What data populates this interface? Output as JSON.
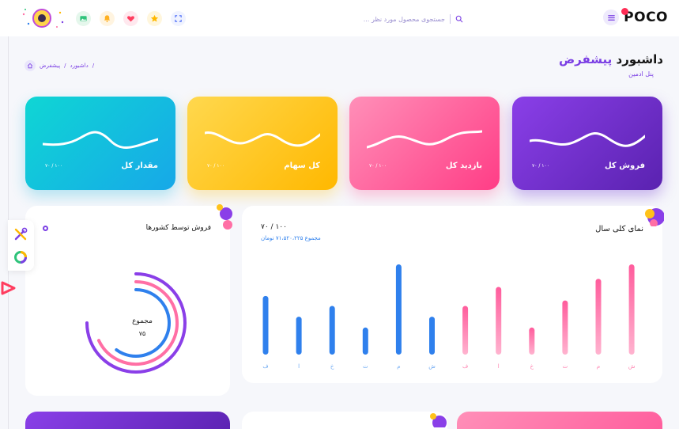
{
  "header": {
    "logo_text": "POCO",
    "search_placeholder": "جستجوی محصول مورد نظر ..."
  },
  "page": {
    "title_main": "داشبورد",
    "title_accent": "پیشفرض",
    "subtitle": "پنل ادمین",
    "breadcrumb": [
      "داشبورد",
      "پیشفرض"
    ]
  },
  "cards": [
    {
      "title": "فروش کل",
      "value": "۱۰۰ / ۷۰",
      "color": "#7b3fe4"
    },
    {
      "title": "بازدید کل",
      "value": "۱۰۰ / ۷۰",
      "color": "#ff4f92"
    },
    {
      "title": "کل سهام",
      "value": "۱۰۰ / ۷۰",
      "color": "#ffc21a"
    },
    {
      "title": "مقدار کل",
      "value": "۱۰۰ / ۷۰",
      "color": "#13c0de"
    }
  ],
  "sales_panel": {
    "title": "نمای کلی سال",
    "value": "۱۰۰ / ۷۰",
    "total": "مجموع ۷۱،۵۲۰،۲۲۵ تومان"
  },
  "country_panel": {
    "title": "فروش توسط کشورها",
    "center_label": "مجموع",
    "center_value": "۷۵"
  },
  "chart_data": {
    "type": "bar",
    "categories": [
      "ف",
      "ا",
      "خ",
      "ت",
      "م",
      "ش",
      "ف",
      "ا",
      "خ",
      "ت",
      "م",
      "ش"
    ],
    "series": [
      {
        "values": [
          65,
          42,
          54,
          30,
          100,
          42,
          null,
          null,
          null,
          null,
          null,
          null
        ],
        "color": "#2f80ed"
      },
      {
        "values": [
          null,
          null,
          null,
          null,
          null,
          null,
          54,
          75,
          30,
          60,
          84,
          100
        ],
        "color": "#ff6fa5"
      }
    ],
    "ylim": [
      0,
      100
    ]
  },
  "donut_data": {
    "rings": [
      {
        "value": 0.75,
        "color": "#8a3fe8"
      },
      {
        "value": 0.68,
        "color": "#ff6fa5"
      },
      {
        "value": 0.6,
        "color": "#2f80ed"
      }
    ]
  }
}
